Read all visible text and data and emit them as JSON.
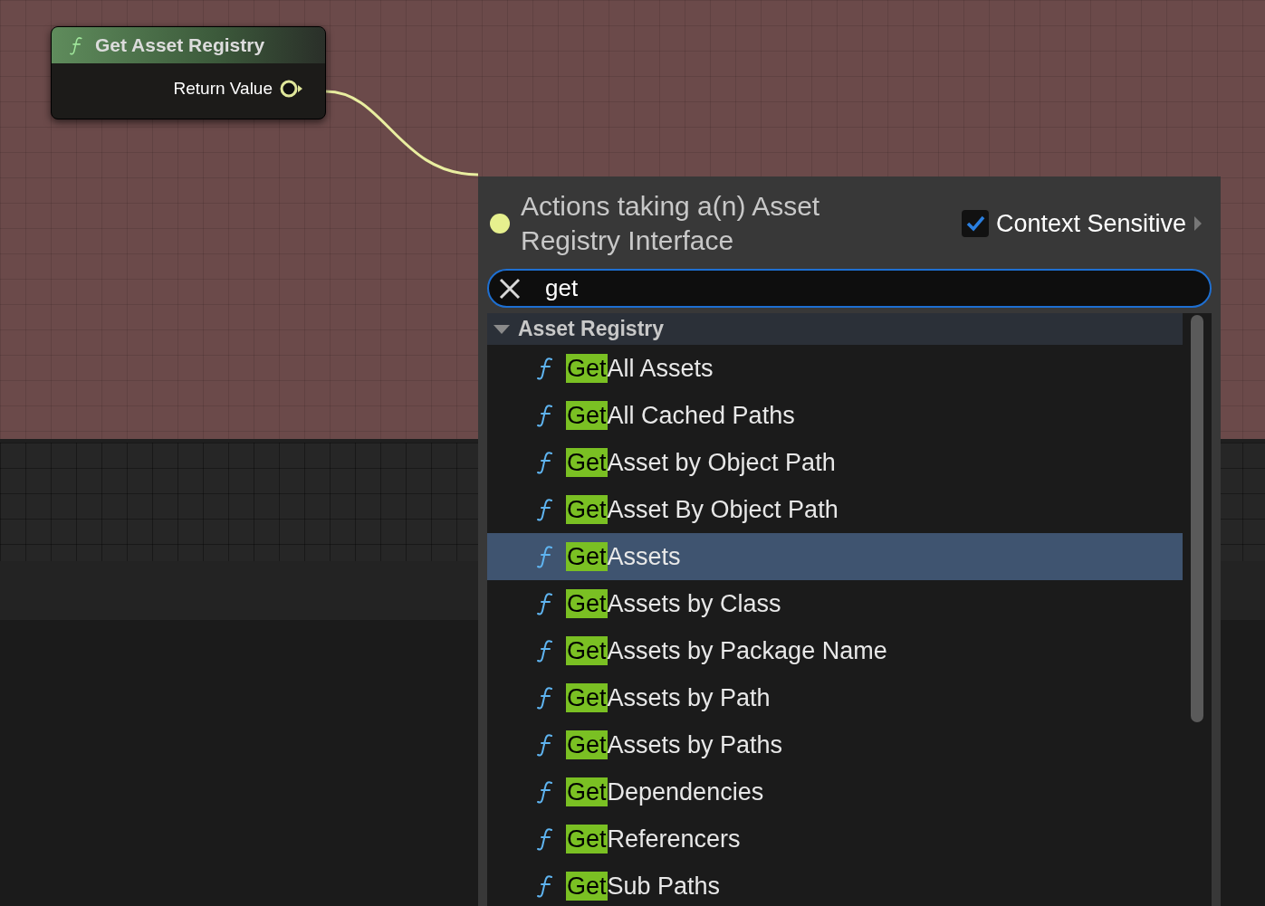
{
  "node": {
    "title": "Get Asset Registry",
    "output": "Return Value"
  },
  "menu": {
    "title": "Actions taking a(n) Asset Registry Interface",
    "context_sensitive": {
      "label": "Context Sensitive",
      "checked": true
    },
    "search": {
      "value": "get"
    },
    "category": {
      "label": "Asset Registry",
      "expanded": true
    },
    "items": [
      {
        "match": "Get",
        "rest": "All Assets",
        "selected": false
      },
      {
        "match": "Get",
        "rest": "All Cached Paths",
        "selected": false
      },
      {
        "match": "Get",
        "rest": "Asset by Object Path",
        "selected": false
      },
      {
        "match": "Get",
        "rest": "Asset By Object Path",
        "selected": false
      },
      {
        "match": "Get",
        "rest": "Assets",
        "selected": true
      },
      {
        "match": "Get",
        "rest": "Assets by Class",
        "selected": false
      },
      {
        "match": "Get",
        "rest": "Assets by Package Name",
        "selected": false
      },
      {
        "match": "Get",
        "rest": "Assets by Path",
        "selected": false
      },
      {
        "match": "Get",
        "rest": "Assets by Paths",
        "selected": false
      },
      {
        "match": "Get",
        "rest": "Dependencies",
        "selected": false
      },
      {
        "match": "Get",
        "rest": "Referencers",
        "selected": false
      },
      {
        "match": "Get",
        "rest": "Sub Paths",
        "selected": false
      }
    ]
  }
}
